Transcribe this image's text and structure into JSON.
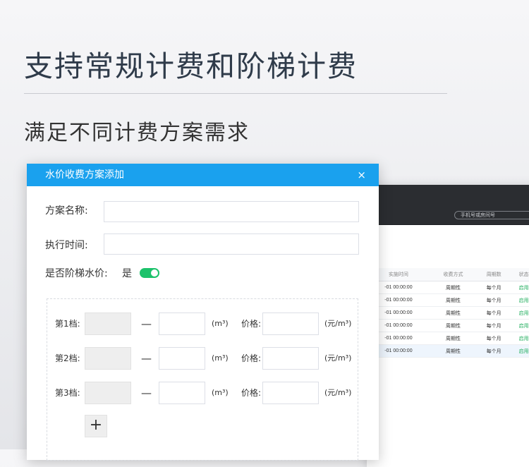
{
  "hero": {
    "title": "支持常规计费和阶梯计费",
    "subtitle": "满足不同计费方案需求"
  },
  "background_app": {
    "search_placeholder": "手机号或房间号",
    "columns": [
      "实施时间",
      "收费方式",
      "周期数",
      "状态"
    ],
    "rows": [
      [
        "-01 00:00:00",
        "周期性",
        "每个月",
        "启用"
      ],
      [
        "-01 00:00:00",
        "周期性",
        "每个月",
        "启用"
      ],
      [
        "-01 00:00:00",
        "周期性",
        "每个月",
        "启用"
      ],
      [
        "-01 00:00:00",
        "周期性",
        "每个月",
        "启用"
      ],
      [
        "-01 00:00:00",
        "周期性",
        "每个月",
        "启用"
      ],
      [
        "-01 00:00:00",
        "周期性",
        "每个月",
        "启用"
      ]
    ]
  },
  "dialog": {
    "title": "水价收费方案添加",
    "close_symbol": "×",
    "plan_name_label": "方案名称:",
    "plan_name_value": "",
    "exec_time_label": "执行时间:",
    "exec_time_value": "",
    "tiered_label": "是否阶梯水价:",
    "tiered_value": "是",
    "tiered_enabled": true,
    "tiers": [
      {
        "label": "第1档:",
        "dash": "—",
        "unit": "(m³)",
        "price_label": "价格:",
        "price_unit": "(元/m³)"
      },
      {
        "label": "第2档:",
        "dash": "—",
        "unit": "(m³)",
        "price_label": "价格:",
        "price_unit": "(元/m³)"
      },
      {
        "label": "第3档:",
        "dash": "—",
        "unit": "(m³)",
        "price_label": "价格:",
        "price_unit": "(元/m³)"
      }
    ],
    "add_tier_symbol": "+"
  },
  "colors": {
    "dialog_header": "#1aa1ee",
    "toggle_on": "#1dc26b",
    "status_enabled": "#1fae5c"
  }
}
